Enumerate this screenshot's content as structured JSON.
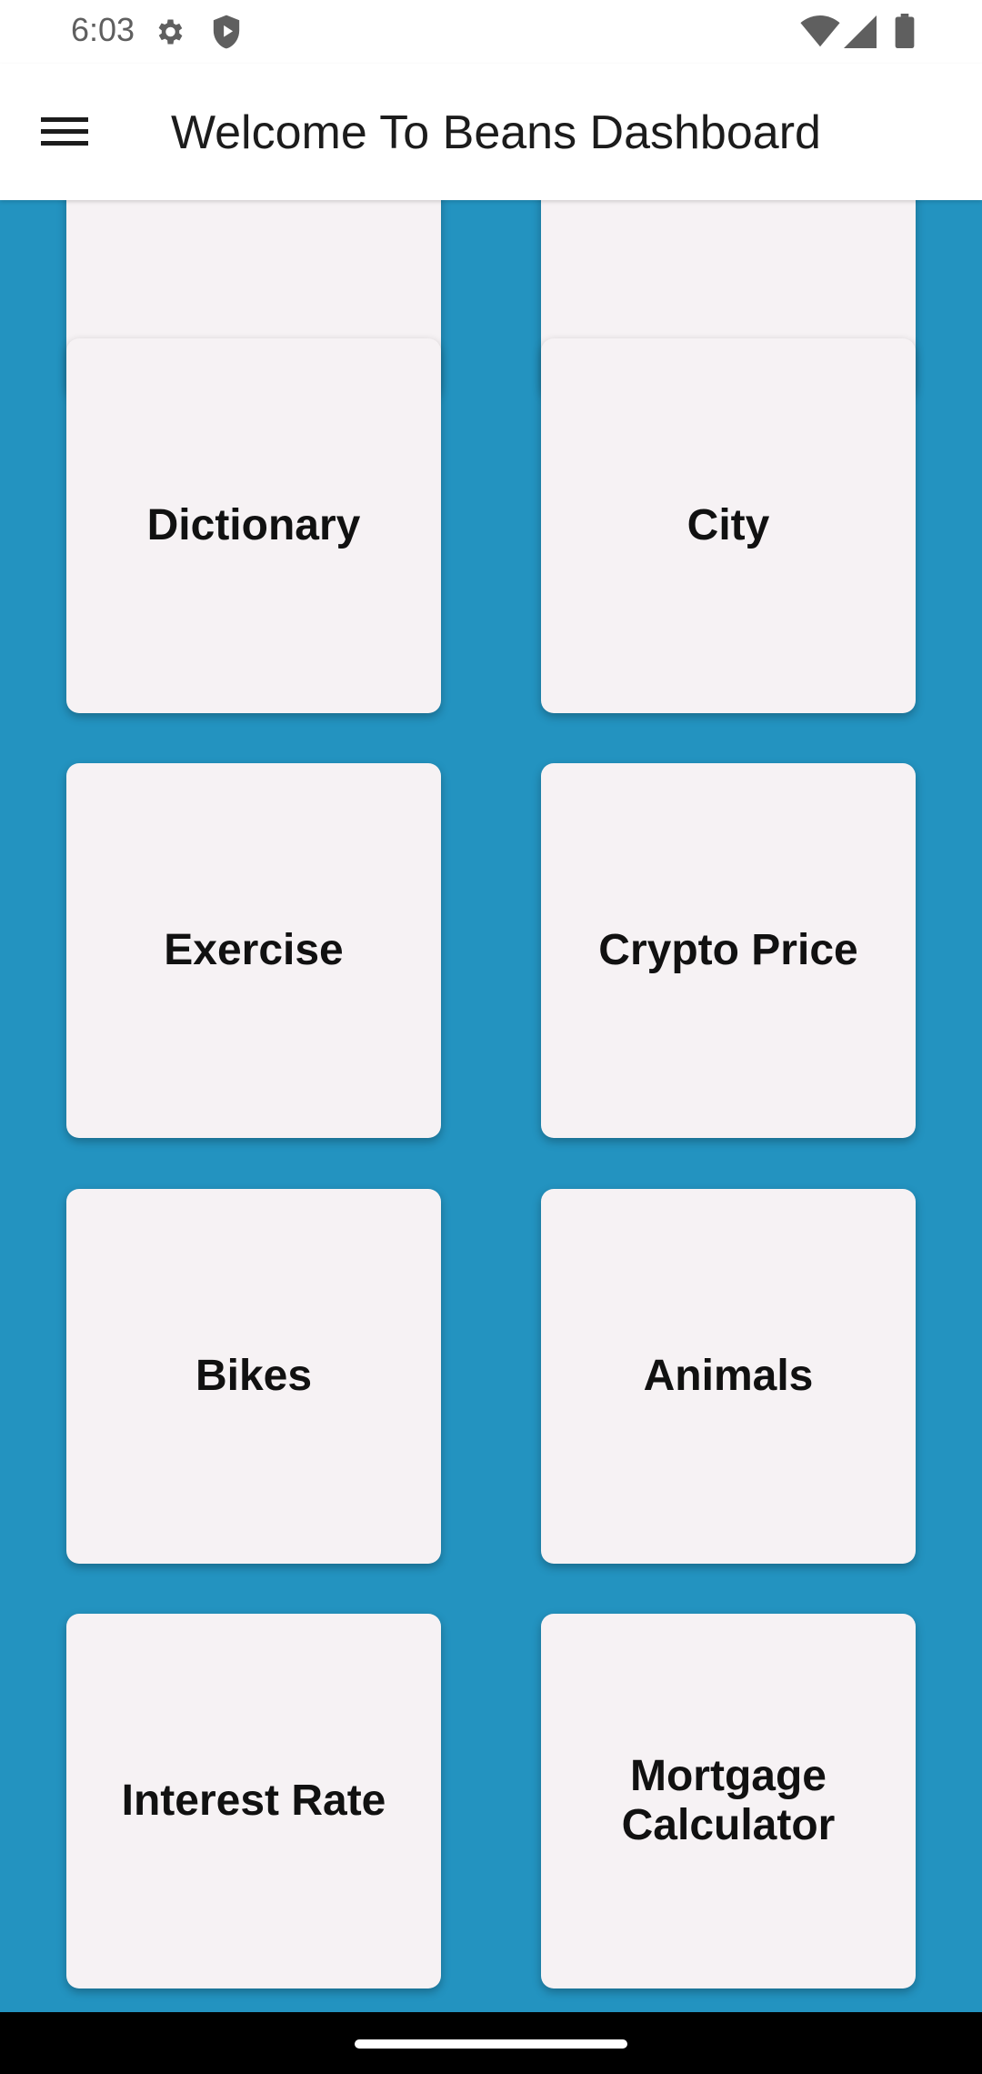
{
  "status_bar": {
    "time": "6:03",
    "icons": [
      "gear-icon",
      "shield-icon",
      "wifi-icon",
      "signal-icon",
      "battery-icon"
    ]
  },
  "app_bar": {
    "title": "Welcome To Beans Dashboard",
    "menu_icon": "hamburger-menu-icon"
  },
  "dashboard": {
    "cards": [
      {
        "label": ""
      },
      {
        "label": ""
      },
      {
        "label": "Dictionary"
      },
      {
        "label": "City"
      },
      {
        "label": "Exercise"
      },
      {
        "label": "Crypto Price"
      },
      {
        "label": "Bikes"
      },
      {
        "label": "Animals"
      },
      {
        "label": "Interest Rate"
      },
      {
        "label": "Mortgage Calculator"
      }
    ]
  },
  "colors": {
    "background": "#2393c0",
    "card": "#f6f2f4",
    "app_bar": "#ffffff",
    "nav_bar": "#000000"
  }
}
